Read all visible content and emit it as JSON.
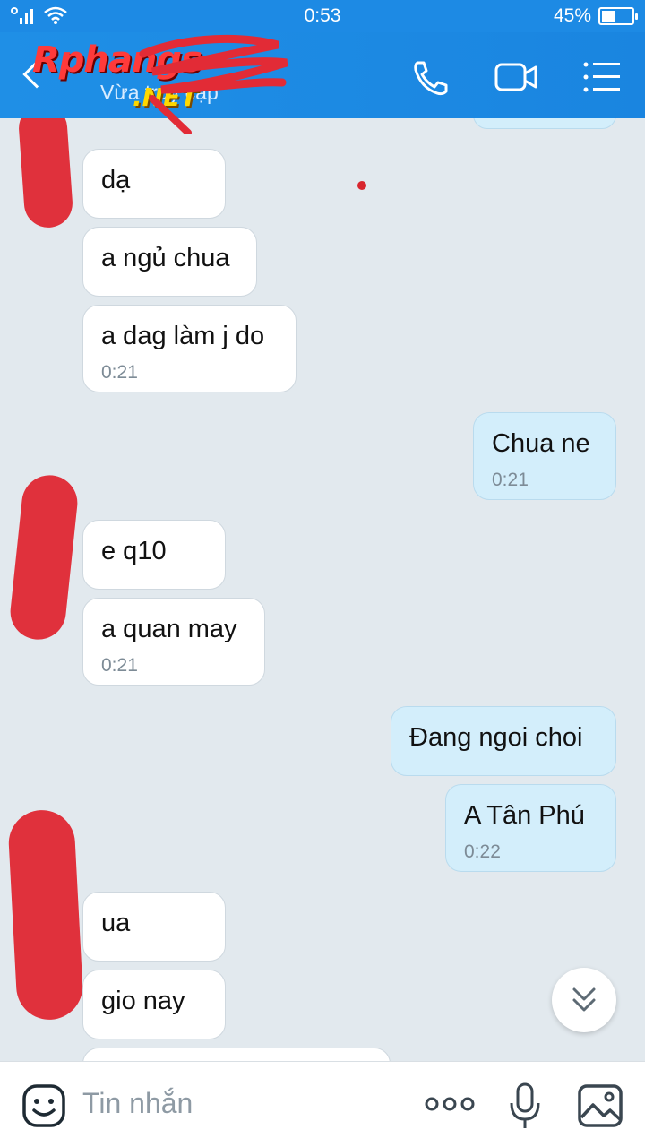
{
  "status_bar": {
    "time": "0:53",
    "battery": "45%",
    "battery_level": 0.45
  },
  "header": {
    "logo_text": "Rphangs",
    "logo_suffix": ".NET",
    "status_text": "Vừa truy cập",
    "icons": [
      "back-icon",
      "phone-icon",
      "video-call-icon",
      "menu-list-icon"
    ]
  },
  "messages": [
    {
      "side": "in",
      "text": "dạ",
      "time": ""
    },
    {
      "side": "in",
      "text": "a ngủ chua",
      "time": ""
    },
    {
      "side": "in",
      "text": "a dag làm j do",
      "time": "0:21"
    },
    {
      "side": "out",
      "text": "Chua ne",
      "time": "0:21"
    },
    {
      "side": "in",
      "text": "e q10",
      "time": ""
    },
    {
      "side": "in",
      "text": "a quan may",
      "time": "0:21"
    },
    {
      "side": "out",
      "text": "Đang ngoi choi",
      "time": ""
    },
    {
      "side": "out",
      "text": "A Tân Phú",
      "time": "0:22"
    },
    {
      "side": "in",
      "text": "ua",
      "time": ""
    },
    {
      "side": "in",
      "text": "gio nay",
      "time": ""
    }
  ],
  "composer": {
    "placeholder": "Tin nhắn",
    "icons": [
      "emoji-icon",
      "more-icon",
      "microphone-icon",
      "image-icon"
    ]
  },
  "colors": {
    "header": "#1d8ae4",
    "incoming": "#ffffff",
    "outgoing": "#d3eefb",
    "redaction": "#e0313c"
  }
}
